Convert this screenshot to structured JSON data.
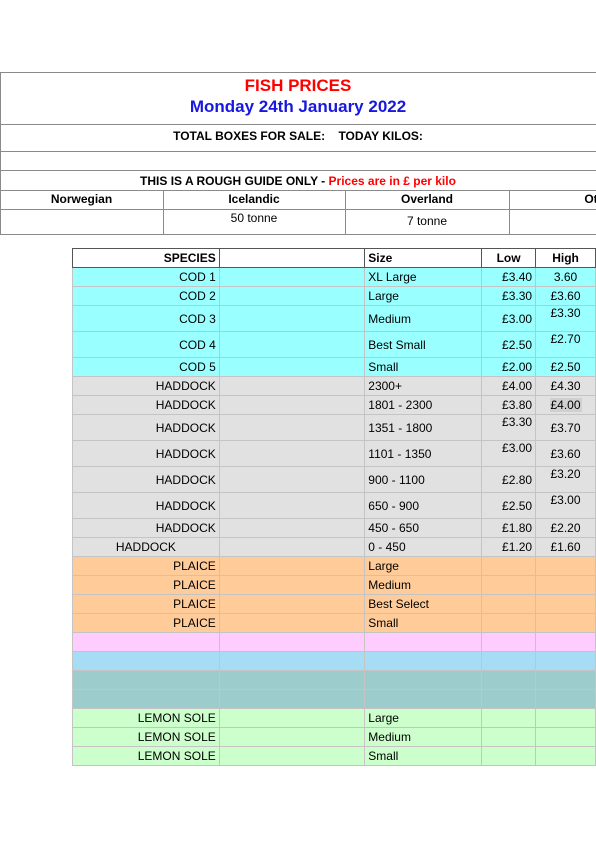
{
  "header": {
    "title": "FISH PRICES",
    "date": "Monday 24th January 2022",
    "boxes_label": "TOTAL BOXES FOR SALE:",
    "kilos_label": "TODAY KILOS:",
    "guide_label": "THIS IS A ROUGH GUIDE ONLY -",
    "guide_red": "Prices are in £ per kilo"
  },
  "origins": [
    {
      "name": "Norwegian",
      "value": ""
    },
    {
      "name": "Icelandic",
      "value": "50 tonne"
    },
    {
      "name": "Overland",
      "value": "7 tonne"
    },
    {
      "name": "Ot",
      "value": ""
    }
  ],
  "table": {
    "headers": {
      "species": "SPECIES",
      "size": "Size",
      "low": "Low",
      "high": "High"
    },
    "rows": [
      {
        "species": "COD 1",
        "size": "XL Large",
        "low": "£3.40",
        "high": "3.60"
      },
      {
        "species": "COD 2",
        "size": "Large",
        "low": "£3.30",
        "high": "£3.60"
      },
      {
        "species": "COD 3",
        "size": "Medium",
        "low": "£3.00",
        "high": "£3.30"
      },
      {
        "species": "COD 4",
        "size": "Best Small",
        "low": "£2.50",
        "high": "£2.70"
      },
      {
        "species": "COD 5",
        "size": "Small",
        "low": "£2.00",
        "high": "£2.50"
      },
      {
        "species": "HADDOCK",
        "size": "2300+",
        "low": "£4.00",
        "high": "£4.30"
      },
      {
        "species": "HADDOCK",
        "size": "1801 - 2300",
        "low": "£3.80",
        "high": "£4.00"
      },
      {
        "species": "HADDOCK",
        "size": "1351 - 1800",
        "low": "£3.30",
        "high": "£3.70"
      },
      {
        "species": "HADDOCK",
        "size": "1101 - 1350",
        "low": "£3.00",
        "high": "£3.60"
      },
      {
        "species": "HADDOCK",
        "size": "900 - 1100",
        "low": "£2.80",
        "high": "£3.20"
      },
      {
        "species": "HADDOCK",
        "size": "650 - 900",
        "low": "£2.50",
        "high": "£3.00"
      },
      {
        "species": "HADDOCK",
        "size": "450 - 650",
        "low": "£1.80",
        "high": "£2.20"
      },
      {
        "species": "HADDOCK",
        "size": "0 - 450",
        "low": "£1.20",
        "high": "£1.60"
      },
      {
        "species": "PLAICE",
        "size": "Large",
        "low": "",
        "high": ""
      },
      {
        "species": "PLAICE",
        "size": "Medium",
        "low": "",
        "high": ""
      },
      {
        "species": "PLAICE",
        "size": "Best Select",
        "low": "",
        "high": ""
      },
      {
        "species": "PLAICE",
        "size": "Small",
        "low": "",
        "high": ""
      },
      {
        "species": "",
        "size": "",
        "low": "",
        "high": ""
      },
      {
        "species": "",
        "size": "",
        "low": "",
        "high": ""
      },
      {
        "species": "",
        "size": "",
        "low": "",
        "high": ""
      },
      {
        "species": "",
        "size": "",
        "low": "",
        "high": ""
      },
      {
        "species": "LEMON SOLE",
        "size": "Large",
        "low": "",
        "high": ""
      },
      {
        "species": "LEMON SOLE",
        "size": "Medium",
        "low": "",
        "high": ""
      },
      {
        "species": "LEMON SOLE",
        "size": "Small",
        "low": "",
        "high": ""
      }
    ]
  }
}
